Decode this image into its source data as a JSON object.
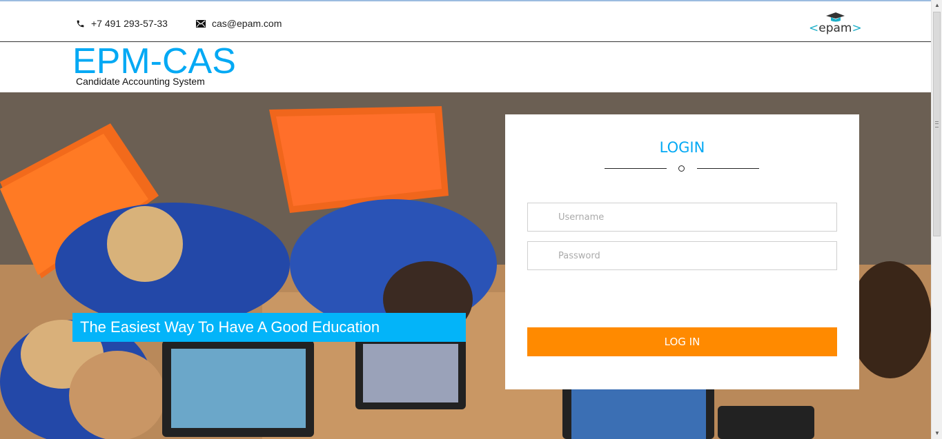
{
  "contact": {
    "phone": "+7 491 293-57-33",
    "email": "cas@epam.com"
  },
  "logo": {
    "left": "<",
    "word": "epam",
    "right": ">"
  },
  "brand": {
    "title": "EPM-CAS",
    "subtitle": "Candidate Accounting System"
  },
  "hero": {
    "tagline": "The Easiest Way To Have A Good Education"
  },
  "login": {
    "title": "LOGIN",
    "username_placeholder": "Username",
    "password_placeholder": "Password",
    "button_label": "LOG IN"
  },
  "colors": {
    "accent": "#03a9f4",
    "tagline_bg": "#03b4f9",
    "button": "#ff8a00"
  }
}
